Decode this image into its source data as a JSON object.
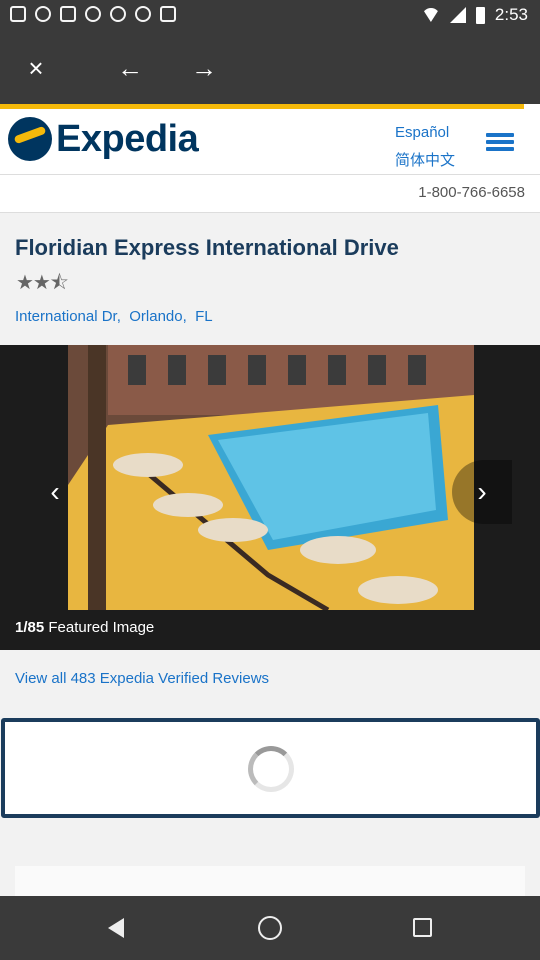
{
  "status_bar": {
    "time": "2:53",
    "left_icons": [
      "mail-icon",
      "steam-icon",
      "grid-icon",
      "link-icon",
      "link-icon",
      "steam-icon",
      "cast-icon"
    ]
  },
  "browser": {
    "close_icon": "×",
    "back_icon": "←",
    "forward_icon": "→",
    "load_progress": 0.97
  },
  "header": {
    "logo_text": "Expedia",
    "lang_es": "Español",
    "lang_zh": "简体中文"
  },
  "phone": "1-800-766-6658",
  "hotel": {
    "name": "Floridian Express International Drive",
    "star_rating": 2.5,
    "stars_display": "★★⯪",
    "address_street": "International Dr,",
    "address_city": "Orlando,",
    "address_state": "FL"
  },
  "gallery": {
    "index": "1/85",
    "caption": "Featured Image",
    "prev_icon": "‹",
    "next_icon": "›"
  },
  "reviews": {
    "link_text": "View all 483 Expedia Verified Reviews"
  },
  "colors": {
    "brand_navy": "#00355f",
    "brand_yellow": "#f5b90a",
    "link_blue": "#1a73c8"
  }
}
